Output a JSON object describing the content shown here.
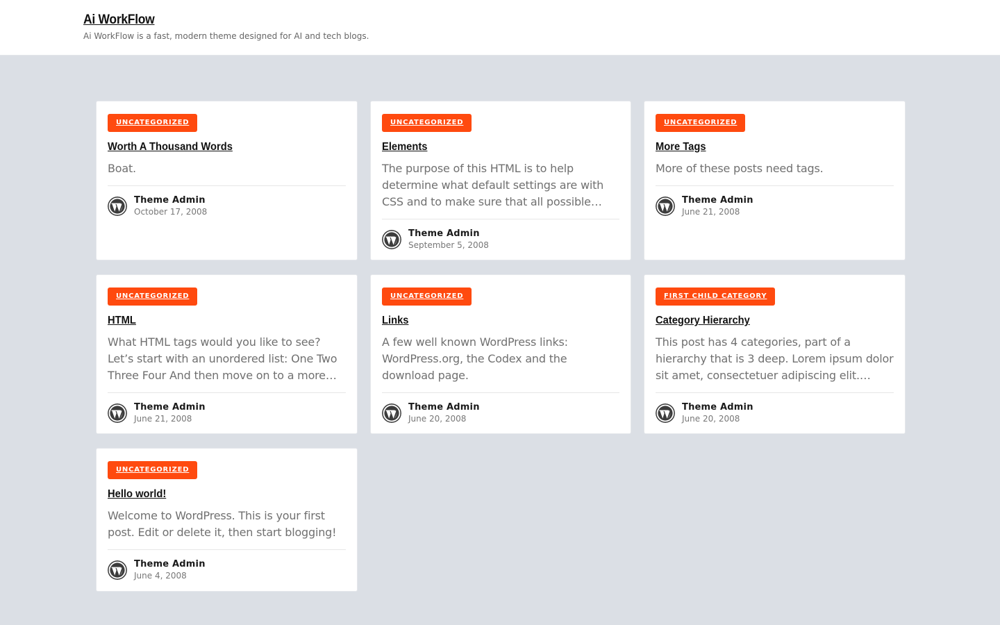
{
  "site": {
    "title": "Ai WorkFlow",
    "tagline": "Ai WorkFlow is a fast, modern theme designed for AI and tech blogs."
  },
  "colors": {
    "accent": "#ff4a0f",
    "background": "#dbdfe5"
  },
  "posts": [
    {
      "category": "UNCATEGORIZED",
      "title": "Worth A Thousand Words",
      "excerpt": "Boat.",
      "author": "Theme Admin",
      "date": "October 17, 2008",
      "avatar_icon": "wordpress-icon"
    },
    {
      "category": "UNCATEGORIZED",
      "title": "Elements",
      "excerpt": "The purpose of this HTML is to help determine what default settings are with CSS and to make sure that all possible…",
      "author": "Theme Admin",
      "date": "September 5, 2008",
      "avatar_icon": "wordpress-icon"
    },
    {
      "category": "UNCATEGORIZED",
      "title": "More Tags",
      "excerpt": "More of these posts need tags.",
      "author": "Theme Admin",
      "date": "June 21, 2008",
      "avatar_icon": "wordpress-icon"
    },
    {
      "category": "UNCATEGORIZED",
      "title": "HTML",
      "excerpt": "What HTML tags would you like to see? Let’s start with an unordered list: One Two Three Four And then move on to a more…",
      "author": "Theme Admin",
      "date": "June 21, 2008",
      "avatar_icon": "wordpress-icon"
    },
    {
      "category": "UNCATEGORIZED",
      "title": "Links",
      "excerpt": "A few well known WordPress links: WordPress.org, the Codex and the download page.",
      "author": "Theme Admin",
      "date": "June 20, 2008",
      "avatar_icon": "wordpress-icon"
    },
    {
      "category": "FIRST CHILD CATEGORY",
      "title": "Category Hierarchy",
      "excerpt": "This post has 4 categories, part of a hierarchy that is 3 deep. Lorem ipsum dolor sit amet, consectetuer adipiscing elit.…",
      "author": "Theme Admin",
      "date": "June 20, 2008",
      "avatar_icon": "wordpress-icon"
    },
    {
      "category": "UNCATEGORIZED",
      "title": "Hello world!",
      "excerpt": "Welcome to WordPress. This is your first post. Edit or delete it, then start blogging!",
      "author": "Theme Admin",
      "date": "June 4, 2008",
      "avatar_icon": "wordpress-icon"
    }
  ]
}
